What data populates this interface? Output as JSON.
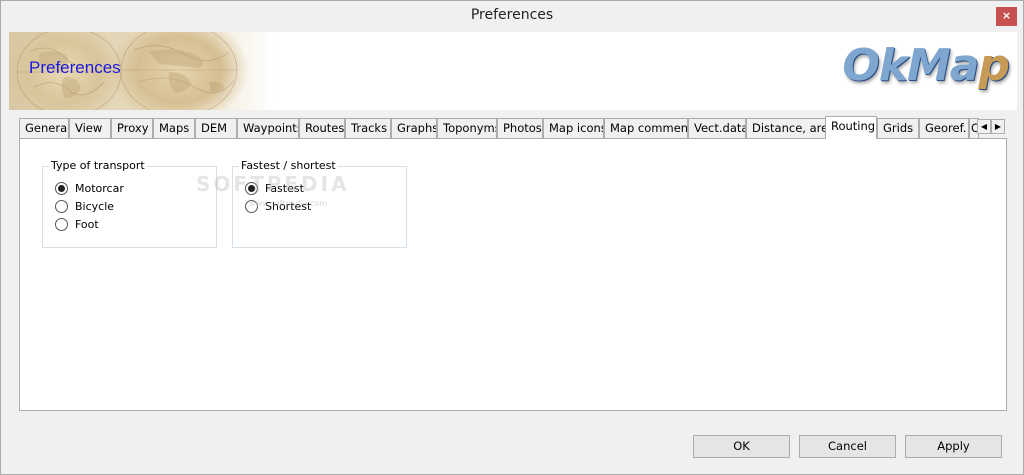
{
  "window": {
    "title": "Preferences"
  },
  "banner": {
    "title": "Preferences",
    "logo": "OkMap"
  },
  "tabs": [
    {
      "label": "General"
    },
    {
      "label": "View"
    },
    {
      "label": "Proxy"
    },
    {
      "label": "Maps"
    },
    {
      "label": "DEM"
    },
    {
      "label": "Waypoints"
    },
    {
      "label": "Routes"
    },
    {
      "label": "Tracks"
    },
    {
      "label": "Graphs"
    },
    {
      "label": "Toponyms"
    },
    {
      "label": "Photos"
    },
    {
      "label": "Map icons"
    },
    {
      "label": "Map comments"
    },
    {
      "label": "Vect.data"
    },
    {
      "label": "Distance, area"
    },
    {
      "label": "Routing"
    },
    {
      "label": "Grids"
    },
    {
      "label": "Georef."
    },
    {
      "label": "C"
    }
  ],
  "active_tab": "Routing",
  "routing": {
    "transport": {
      "legend": "Type of transport",
      "options": [
        {
          "label": "Motorcar",
          "checked": true
        },
        {
          "label": "Bicycle",
          "checked": false
        },
        {
          "label": "Foot",
          "checked": false
        }
      ]
    },
    "fastest": {
      "legend": "Fastest / shortest",
      "options": [
        {
          "label": "Fastest",
          "checked": true
        },
        {
          "label": "Shortest",
          "checked": false
        }
      ]
    }
  },
  "watermark": {
    "text": "SOFTPEDIA",
    "sub": "www.softpedia.com"
  },
  "buttons": {
    "ok": "OK",
    "cancel": "Cancel",
    "apply": "Apply"
  }
}
